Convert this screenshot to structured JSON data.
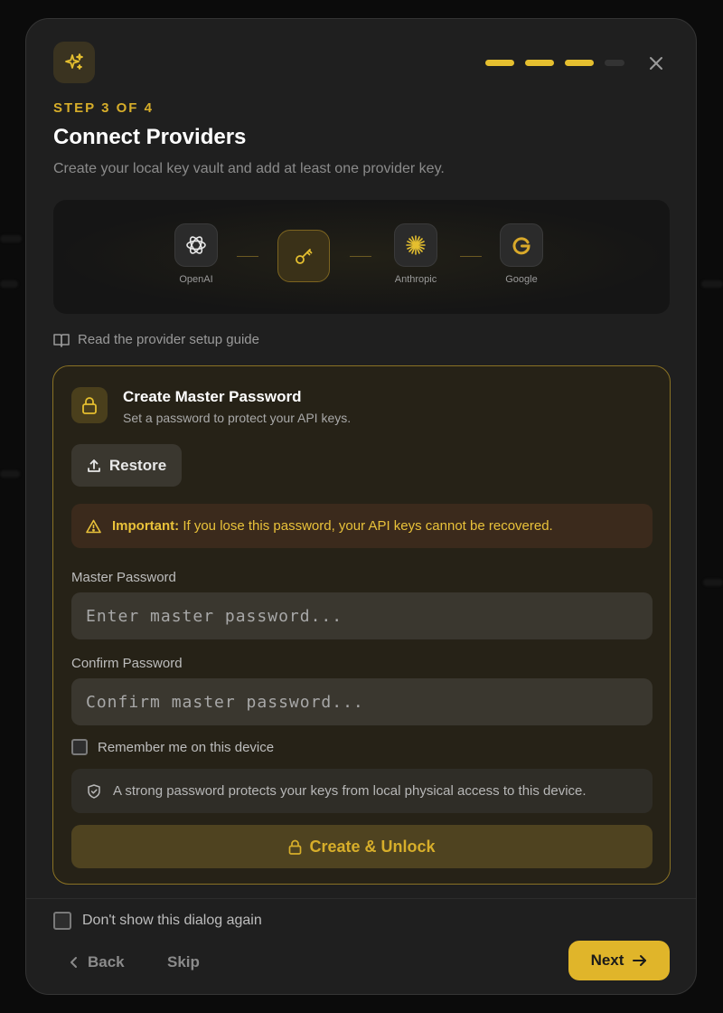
{
  "colors": {
    "accent": "#e0b52a",
    "card_border": "#8a7224",
    "warning_bg": "#3b2a1c"
  },
  "header": {
    "icon": "sparkles-icon",
    "progress": {
      "steps_total": 4,
      "steps_complete": 3
    },
    "close_icon": "close-icon"
  },
  "step_label": "STEP 3 OF 4",
  "title": "Connect Providers",
  "subtitle": "Create your local key vault and add at least one provider key.",
  "providers": [
    {
      "name": "OpenAI",
      "icon": "openai-icon"
    },
    {
      "name": "",
      "icon": "key-icon",
      "active": true
    },
    {
      "name": "Anthropic",
      "icon": "anthropic-icon"
    },
    {
      "name": "Google",
      "icon": "google-icon"
    }
  ],
  "guide_link": "Read the provider setup guide",
  "card": {
    "title": "Create Master Password",
    "subtitle": "Set a password to protect your API keys.",
    "restore_label": "Restore",
    "alert_strong": "Important:",
    "alert_text": " If you lose this password, your API keys cannot be recovered.",
    "master_label": "Master Password",
    "master_placeholder": "Enter master password...",
    "confirm_label": "Confirm Password",
    "confirm_placeholder": "Confirm master password...",
    "remember_label": "Remember me on this device",
    "info_text": "A strong password protects your keys from local physical access to this device.",
    "primary_label": "Create & Unlock"
  },
  "footer": {
    "dont_show_label": "Don't show this dialog again",
    "back_label": "Back",
    "skip_label": "Skip",
    "next_label": "Next"
  }
}
